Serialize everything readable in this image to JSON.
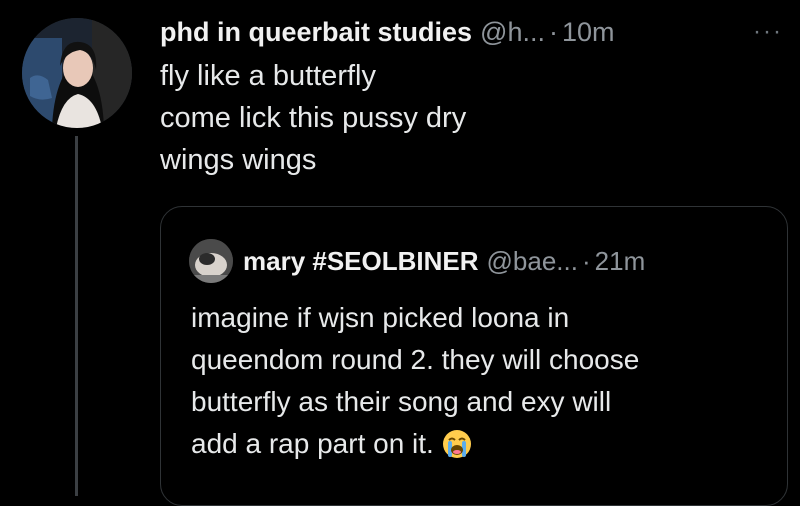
{
  "tweet": {
    "author": {
      "display_name": "phd in queerbait studies",
      "handle": "@h...",
      "separator": "·",
      "time": "10m",
      "avatar_icon": "profile-photo-icon"
    },
    "more_icon": "more-options-icon",
    "more_label": "···",
    "lines": [
      "fly like a butterfly",
      "come lick this pussy dry",
      "wings wings"
    ]
  },
  "quote": {
    "author": {
      "display_name": "mary #SEOLBINER",
      "handle": "@bae...",
      "separator": "·",
      "time": "21m",
      "avatar_icon": "profile-photo-icon"
    },
    "lines": [
      "imagine if wjsn picked loona in",
      "queendom round 2. they will choose",
      "butterfly as their song and exy will",
      "add a rap part on it."
    ],
    "emoji_icon": "loudly-crying-face-emoji-icon"
  },
  "colors": {
    "background": "#000000",
    "text": "#e7e9ea",
    "secondary_text": "#8f959b",
    "border": "#2f3336"
  }
}
